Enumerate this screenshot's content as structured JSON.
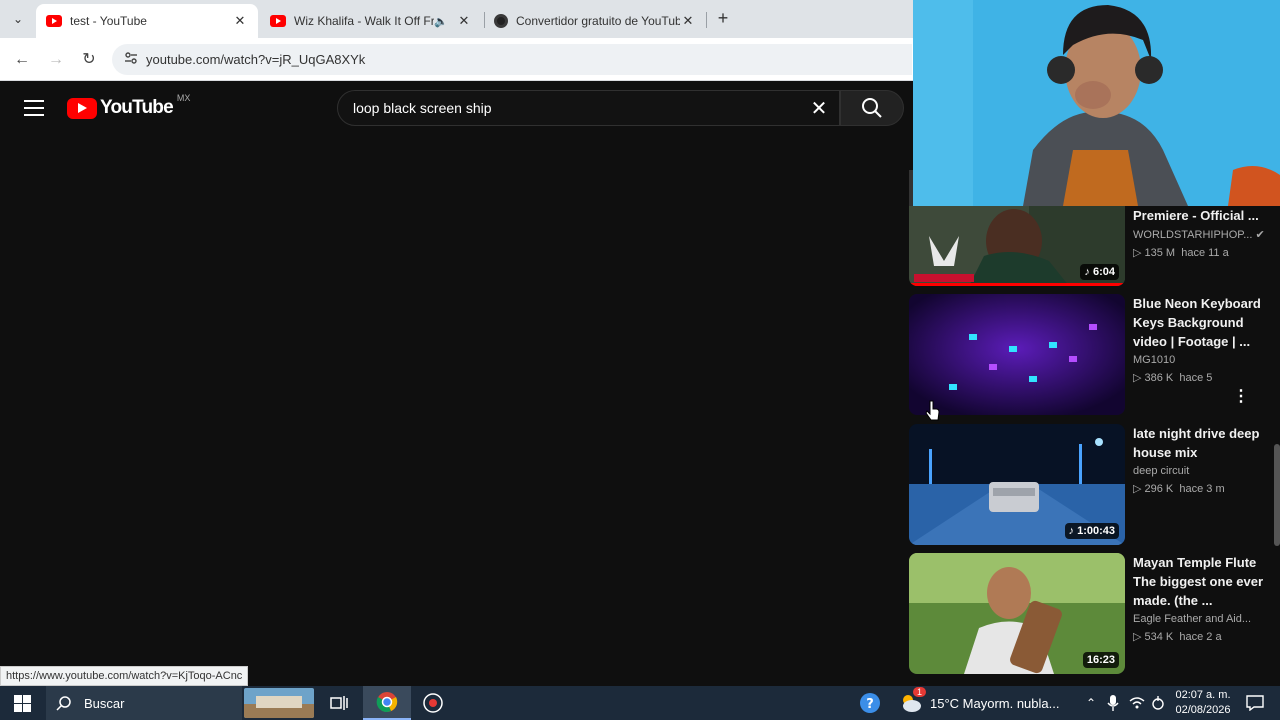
{
  "browser": {
    "tabs": [
      {
        "title": "test - YouTube",
        "active": true
      },
      {
        "title": "Wiz Khalifa - Walk It Off Fre",
        "audio": true
      },
      {
        "title": "Convertidor gratuito de YouTub"
      }
    ],
    "url": "youtube.com/watch?v=jR_UqGA8XYk"
  },
  "youtube": {
    "logo_text": "YouTube",
    "country_code": "MX",
    "search_query": "loop black screen ship"
  },
  "recommendations": [
    {
      "title": "Premiere - Official ...",
      "channel": "WORLDSTARHIPHOP...",
      "views": "▷ 135 M",
      "age": "hace 11 a",
      "duration": "6:04",
      "verified": true
    },
    {
      "title": "Blue Neon Keyboard Keys Background video | Footage | ...",
      "channel": "MG1010",
      "views": "▷ 386 K",
      "age": "hace 5"
    },
    {
      "title": "late night drive deep house mix",
      "channel": "deep circuit",
      "views": "▷ 296 K",
      "age": "hace 3 m",
      "duration": "1:00:43"
    },
    {
      "title": "Mayan Temple Flute The biggest one ever made. (the ...",
      "channel": "Eagle Feather and Aid...",
      "views": "▷ 534 K",
      "age": "hace 2 a",
      "duration": "16:23"
    }
  ],
  "status_link": "https://www.youtube.com/watch?v=KjToqo-ACnc",
  "taskbar": {
    "search_placeholder": "Buscar",
    "weather": "15°C  Mayorm. nubla...",
    "notification_badge": "1",
    "time": "02:07 a. m.",
    "date": "02/08/2026"
  }
}
